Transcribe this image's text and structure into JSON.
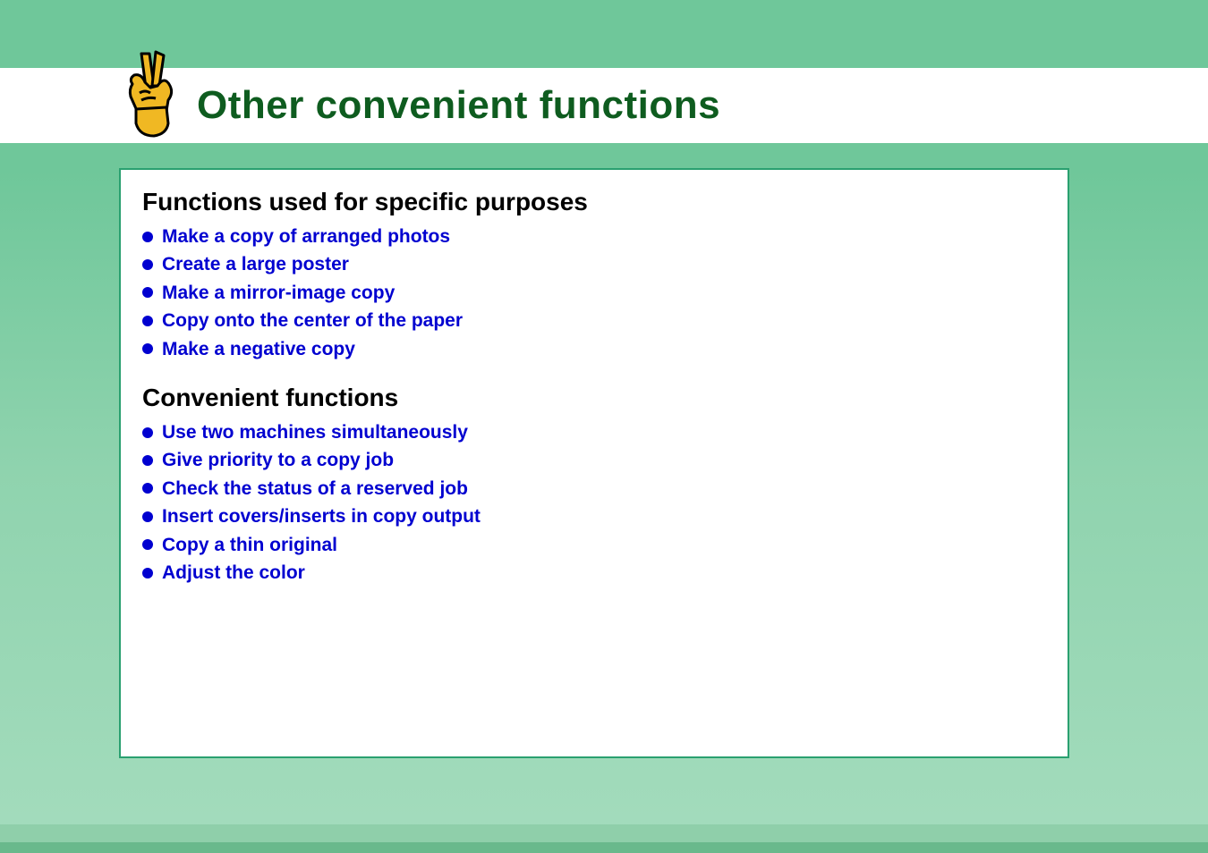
{
  "header": {
    "icon": "peace-hand-icon",
    "title": "Other convenient functions"
  },
  "sections": [
    {
      "heading": "Functions used for specific purposes",
      "items": [
        "Make a copy of arranged photos",
        "Create a large poster",
        "Make a mirror-image copy",
        "Copy onto the center of the paper",
        "Make a negative copy"
      ]
    },
    {
      "heading": "Convenient functions",
      "items": [
        "Use two machines simultaneously",
        "Give priority to a copy job",
        "Check the status of a reserved job",
        "Insert covers/inserts in copy output",
        "Copy a thin original",
        "Adjust the color"
      ]
    }
  ],
  "colors": {
    "background_green": "#6fc79a",
    "border_green": "#2aa070",
    "title_text": "#0e5c1f",
    "link_blue": "#0000d0"
  }
}
